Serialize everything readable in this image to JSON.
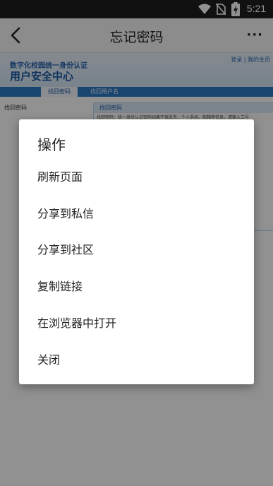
{
  "status_bar": {
    "time": "5:21"
  },
  "toolbar": {
    "title": "忘记密码",
    "more": "···"
  },
  "web": {
    "banner_line1": "数字化校园统一身份认证",
    "banner_line2": "用户安全中心",
    "banner_links": "登录 | 我的主页",
    "tab_active": "找回密码",
    "tab_inactive": "找回用户名",
    "left_panel_title": "找回密码",
    "right_panel_title": "找回密码",
    "right_panel_text": "找回密码：统一身份认证密码如果不慎丢失，个人手机、邮箱等信息，请输入工号"
  },
  "dialog": {
    "title": "操作",
    "items": [
      {
        "label": "刷新页面"
      },
      {
        "label": "分享到私信"
      },
      {
        "label": "分享到社区"
      },
      {
        "label": "复制链接"
      },
      {
        "label": "在浏览器中打开"
      },
      {
        "label": "关闭"
      }
    ]
  }
}
